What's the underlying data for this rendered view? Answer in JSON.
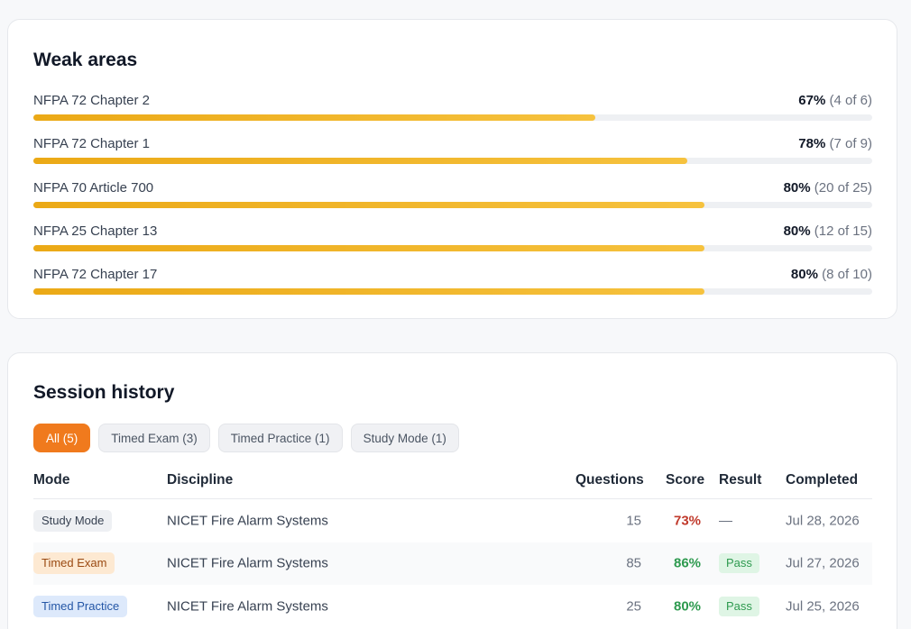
{
  "weak_areas": {
    "title": "Weak areas",
    "items": [
      {
        "label": "NFPA 72 Chapter 2",
        "pct": "67%",
        "detail": "(4 of 6)",
        "value": 0.67
      },
      {
        "label": "NFPA 72 Chapter 1",
        "pct": "78%",
        "detail": "(7 of 9)",
        "value": 0.78
      },
      {
        "label": "NFPA 70 Article 700",
        "pct": "80%",
        "detail": "(20 of 25)",
        "value": 0.8
      },
      {
        "label": "NFPA 25 Chapter 13",
        "pct": "80%",
        "detail": "(12 of 15)",
        "value": 0.8
      },
      {
        "label": "NFPA 72 Chapter 17",
        "pct": "80%",
        "detail": "(8 of 10)",
        "value": 0.8
      }
    ]
  },
  "session_history": {
    "title": "Session history",
    "filters": [
      {
        "label": "All (5)",
        "active": true
      },
      {
        "label": "Timed Exam (3)",
        "active": false
      },
      {
        "label": "Timed Practice (1)",
        "active": false
      },
      {
        "label": "Study Mode (1)",
        "active": false
      }
    ],
    "columns": {
      "mode": "Mode",
      "discipline": "Discipline",
      "questions": "Questions",
      "score": "Score",
      "result": "Result",
      "completed": "Completed"
    },
    "rows": [
      {
        "mode": "Study Mode",
        "discipline": "NICET Fire Alarm Systems",
        "questions": "15",
        "score": "73%",
        "result": "—",
        "completed": "Jul 28, 2026"
      },
      {
        "mode": "Timed Exam",
        "discipline": "NICET Fire Alarm Systems",
        "questions": "85",
        "score": "86%",
        "result": "Pass",
        "completed": "Jul 27, 2026"
      },
      {
        "mode": "Timed Practice",
        "discipline": "NICET Fire Alarm Systems",
        "questions": "25",
        "score": "80%",
        "result": "Pass",
        "completed": "Jul 25, 2026"
      }
    ]
  },
  "colors": {
    "accent": "#f07a1d",
    "bar": "#f2b631",
    "score_fail": "#c0392b",
    "score_pass": "#2e9a4f",
    "pass_badge_bg": "#dff5e5",
    "pass_badge_fg": "#2e9a4f",
    "study_badge_bg": "#eef0f3",
    "exam_badge_bg": "#fde9d2",
    "practice_badge_bg": "#dde9fb"
  }
}
